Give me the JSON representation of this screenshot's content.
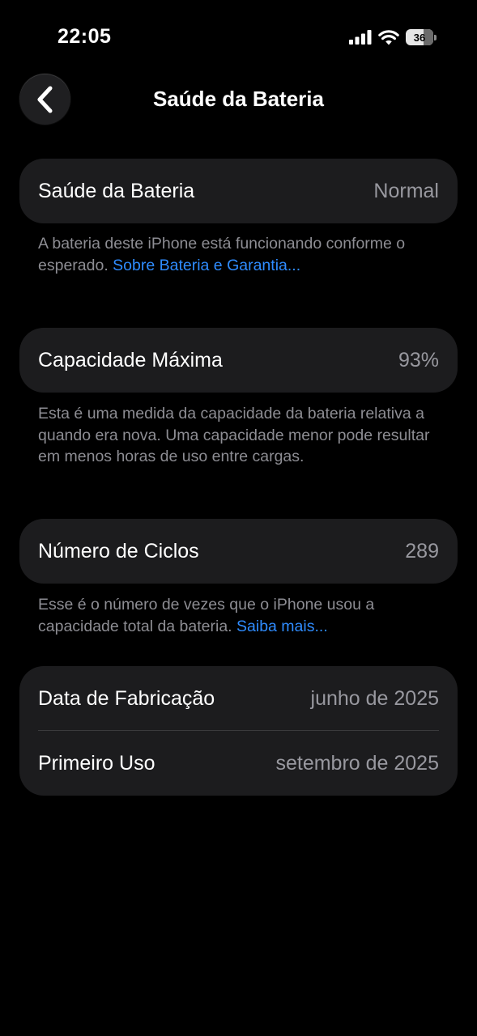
{
  "status_bar": {
    "time": "22:05",
    "battery_level": "36"
  },
  "nav": {
    "title": "Saúde da Bateria",
    "back_icon": "chevron-left-icon"
  },
  "health": {
    "label": "Saúde da Bateria",
    "value": "Normal",
    "description": "A bateria deste iPhone está funcionando conforme o esperado. ",
    "link": "Sobre Bateria e Garantia..."
  },
  "capacity": {
    "label": "Capacidade Máxima",
    "value": "93%",
    "description": "Esta é uma medida da capacidade da bateria relativa a quando era nova. Uma capacidade menor pode resultar em menos horas de uso entre cargas."
  },
  "cycles": {
    "label": "Número de Ciclos",
    "value": "289",
    "description": "Esse é o número de vezes que o iPhone usou a capacidade total da bateria. ",
    "link": "Saiba mais..."
  },
  "dates": {
    "manufacture_label": "Data de Fabricação",
    "manufacture_value": "junho de 2025",
    "first_use_label": "Primeiro Uso",
    "first_use_value": "setembro de 2025"
  },
  "colors": {
    "background": "#000000",
    "card": "#1c1c1e",
    "link": "#2f8cff",
    "secondary_text": "#98989f"
  }
}
